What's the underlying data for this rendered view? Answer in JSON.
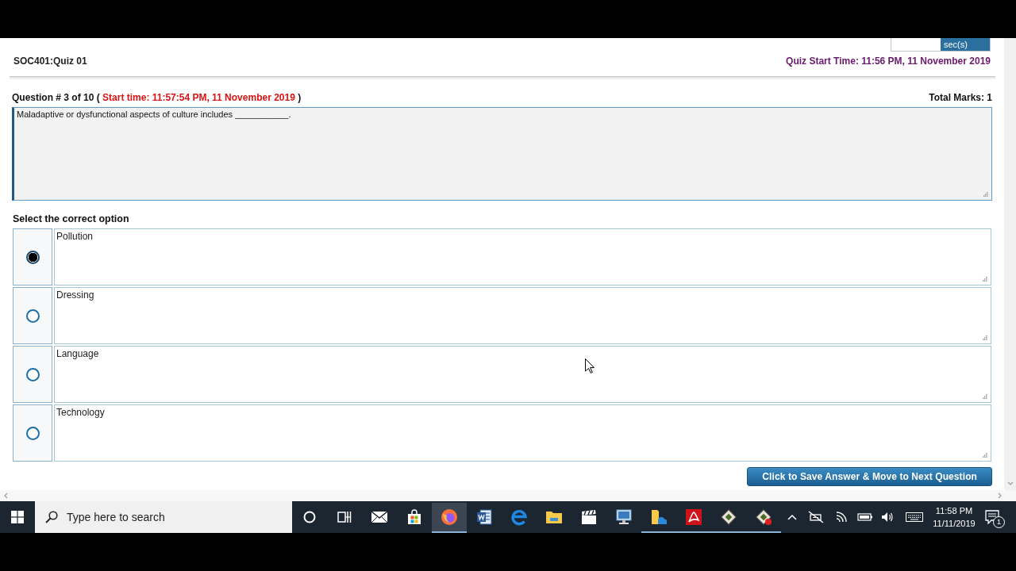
{
  "quiz": {
    "title": "SOC401:Quiz 01",
    "timer_unit": "sec(s)",
    "start_time": "Quiz Start Time: 11:56 PM, 11 November 2019"
  },
  "question": {
    "number": "Question # 3 of 10 (",
    "start_time": "Start time: 11:57:54 PM, 11 November 2019",
    "closing": ")",
    "total_marks": "Total Marks: 1",
    "text": "Maladaptive or dysfunctional aspects of culture includes ___________."
  },
  "instruction": "Select the correct option",
  "options": [
    {
      "label": "Pollution",
      "selected": true
    },
    {
      "label": "Dressing",
      "selected": false
    },
    {
      "label": "Language",
      "selected": false
    },
    {
      "label": "Technology",
      "selected": false
    }
  ],
  "save_button": "Click to Save Answer & Move to Next Question",
  "taskbar": {
    "search_placeholder": "Type here to search",
    "apps": [
      {
        "kind": "circle",
        "selected": false,
        "running": false
      },
      {
        "kind": "task-view",
        "selected": false,
        "running": false
      },
      {
        "kind": "mail",
        "selected": false,
        "running": false
      },
      {
        "kind": "store",
        "selected": false,
        "running": false
      },
      {
        "kind": "browser",
        "selected": true,
        "running": true
      },
      {
        "kind": "word",
        "selected": false,
        "running": false
      },
      {
        "kind": "edge",
        "selected": false,
        "running": false
      },
      {
        "kind": "folder",
        "selected": false,
        "running": false
      },
      {
        "kind": "film",
        "selected": false,
        "running": false
      },
      {
        "kind": "computer",
        "selected": false,
        "running": false
      },
      {
        "kind": "cloud-folder",
        "selected": false,
        "running": true
      },
      {
        "kind": "pdf",
        "selected": false,
        "running": true
      },
      {
        "kind": "diamond",
        "selected": false,
        "running": true
      },
      {
        "kind": "diamond-badge",
        "selected": false,
        "running": true
      }
    ],
    "clock_time": "11:58 PM",
    "clock_date": "11/11/2019",
    "notification_count": "1"
  }
}
